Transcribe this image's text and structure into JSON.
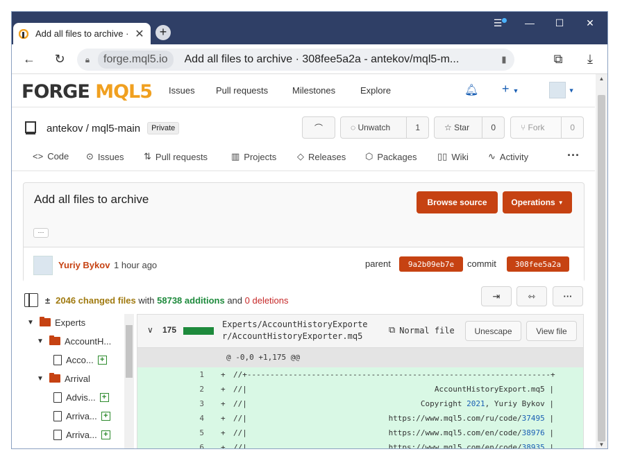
{
  "browser": {
    "tab_title": "Add all files to archive ·",
    "domain": "forge.mql5.io",
    "page_title": "Add all files to archive · 308fee5a2a - antekov/mql5-m..."
  },
  "site": {
    "logo_a": "FORGE",
    "logo_b": "MQL5",
    "nav": [
      "Issues",
      "Pull requests",
      "Milestones",
      "Explore"
    ]
  },
  "repo": {
    "name": "antekov / mql5-main",
    "visibility": "Private",
    "unwatch_label": "Unwatch",
    "watch_count": "1",
    "star_label": "Star",
    "star_count": "0",
    "fork_label": "Fork",
    "fork_count": "0",
    "tabs": [
      "Code",
      "Issues",
      "Pull requests",
      "Projects",
      "Releases",
      "Packages",
      "Wiki",
      "Activity"
    ]
  },
  "commit": {
    "title": "Add all files to archive",
    "browse_label": "Browse source",
    "operations_label": "Operations",
    "expand_label": "···",
    "author": "Yuriy Bykov",
    "time": "1 hour ago",
    "parent_label": "parent",
    "parent_sha": "9a2b09eb7e",
    "commit_label": "commit",
    "commit_sha": "308fee5a2a"
  },
  "stats": {
    "changed": "2046 changed files",
    "with": "with",
    "additions": "58738 additions",
    "and": "and",
    "deletions": "0 deletions"
  },
  "tree": [
    {
      "label": "Experts",
      "kind": "folder",
      "indent": 0,
      "open": true
    },
    {
      "label": "AccountH...",
      "kind": "folder",
      "indent": 1,
      "open": true
    },
    {
      "label": "Acco...",
      "kind": "file",
      "indent": 2
    },
    {
      "label": "Arrival",
      "kind": "folder",
      "indent": 1,
      "open": true
    },
    {
      "label": "Advis...",
      "kind": "file",
      "indent": 2
    },
    {
      "label": "Arriva...",
      "kind": "file",
      "indent": 2
    },
    {
      "label": "Arriva...",
      "kind": "file",
      "indent": 2
    }
  ],
  "diff": {
    "count": "175",
    "path": "Experts/AccountHistoryExporter/AccountHistoryExporter.mq5",
    "path_line1": "Experts/AccountHistoryExporte",
    "path_line2": "r/AccountHistoryExporter.mq5",
    "file_type": "Normal file",
    "unescape_label": "Unescape",
    "view_label": "View file",
    "hunk": "@ -0,0 +1,175 @@",
    "lines": [
      {
        "n": "1",
        "sign": "+",
        "left": "//+------------------------------------------------------------------+",
        "right": ""
      },
      {
        "n": "2",
        "sign": "+",
        "left": "//|",
        "right": "AccountHistoryExport.mq5 |"
      },
      {
        "n": "3",
        "sign": "+",
        "left": "//|",
        "right_pre": "Copyright ",
        "right_num": "2021",
        "right_post": ", Yuriy Bykov |"
      },
      {
        "n": "4",
        "sign": "+",
        "left": "//|",
        "right_pre": "https://www.mql5.com/ru/code/",
        "right_num": "37495",
        "right_post": " |"
      },
      {
        "n": "5",
        "sign": "+",
        "left": "//|",
        "right_pre": "https://www.mql5.com/en/code/",
        "right_num": "38976",
        "right_post": " |"
      },
      {
        "n": "6",
        "sign": "+",
        "left": "//|",
        "right_pre": "https://www.mql5.com/en/code/",
        "right_num": "38935",
        "right_post": " |"
      }
    ]
  }
}
